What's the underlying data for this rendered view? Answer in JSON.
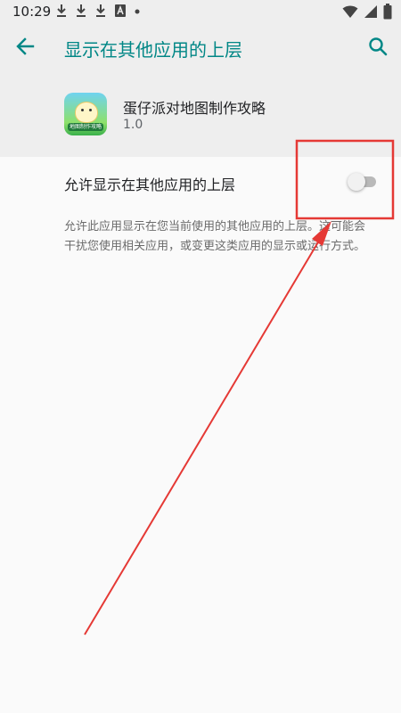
{
  "status_bar": {
    "time": "10:29",
    "left_icons": [
      "download-icon",
      "download-icon",
      "download-icon",
      "font-icon",
      "dot-icon"
    ],
    "right_icons": [
      "wifi-icon",
      "signal-icon",
      "battery-icon"
    ]
  },
  "app_bar": {
    "title": "显示在其他应用的上层",
    "back_icon": "arrow-left-icon",
    "search_icon": "search-icon"
  },
  "app_info": {
    "name": "蛋仔派对地图制作攻略",
    "version": "1.0",
    "icon_banner": "地图制作攻略"
  },
  "permission": {
    "label": "允许显示在其他应用的上层",
    "enabled": false,
    "description": "允许此应用显示在您当前使用的其他应用的上层。这可能会干扰您使用相关应用，或变更这类应用的显示或运行方式。"
  },
  "colors": {
    "accent": "#018786",
    "annotation": "#e53935",
    "header_bg": "#eeeeee",
    "page_bg": "#fafafa"
  }
}
